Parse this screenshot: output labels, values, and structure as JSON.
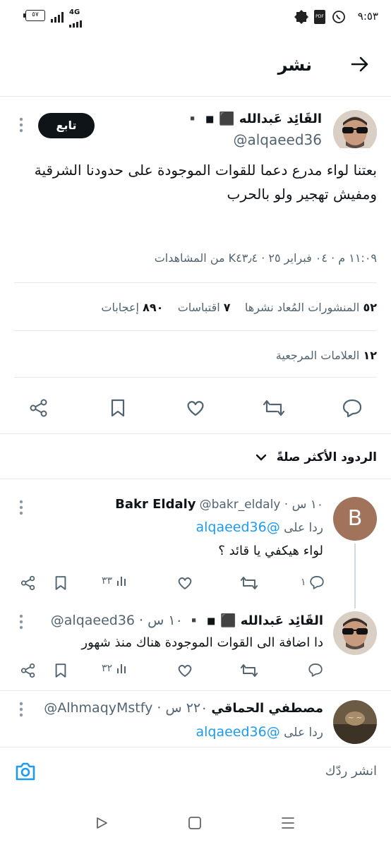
{
  "status_bar": {
    "time": "٩:٥٣",
    "battery": "٥٧",
    "network": "4G"
  },
  "header": {
    "title": "نشر",
    "back_icon": "arrow-right-icon"
  },
  "tweet": {
    "author_name": "القَائِد عَبدالله ⬛ ◾ ▪️",
    "author_handle": "@alqaeed36",
    "follow_label": "تابع",
    "text_line1": "بعتنا لواء مدرع دعما للقوات الموجودة على حدودنا الشرقية",
    "text_line2": "ومفيش تهجير ولو بالحرب",
    "meta": "١١:٠٩ م · ٠٤ فبراير ٢٥ · K٤٣٫٤ من المشاهدات",
    "reposts_count": "٥٢",
    "reposts_label": "المنشورات المُعاد نشرها",
    "quotes_count": "٧",
    "quotes_label": "اقتباسات",
    "likes_count": "٨٩٠",
    "likes_label": "إعجابات",
    "bookmarks_count": "١٢",
    "bookmarks_label": "العلامات المرجعية"
  },
  "replies_header": {
    "label": "الردود الأكثر صلةً"
  },
  "replies": [
    {
      "avatar_letter": "B",
      "name": "Bakr Eldaly",
      "handle_time": "@bakr_eldaly · ١٠ س",
      "reply_to_prefix": "ردا على",
      "reply_to_handle": "@alqaeed36",
      "text": "لواء هيكفي يا قائد ؟",
      "reply_count": "١",
      "views": "٣٣"
    },
    {
      "name": "القَائِد عَبدالله ⬛ ◾ ▪️",
      "handle_time": "@alqaeed36 · ١٠ س",
      "text": "دا اضافة الى القوات الموجودة هناك منذ شهور",
      "views": "٣٢"
    },
    {
      "name": "مصطفي الحماقي",
      "handle_time": "@AlhmaqyMstfy · ٢٢٠ س",
      "reply_to_prefix": "ردا على",
      "reply_to_handle": "@alqaeed36"
    }
  ],
  "compose": {
    "placeholder": "انشر ردّك"
  },
  "colors": {
    "accent": "#1d9bf0",
    "text": "#0f1419",
    "muted": "#536471",
    "avatar_b": "#a0735a"
  }
}
